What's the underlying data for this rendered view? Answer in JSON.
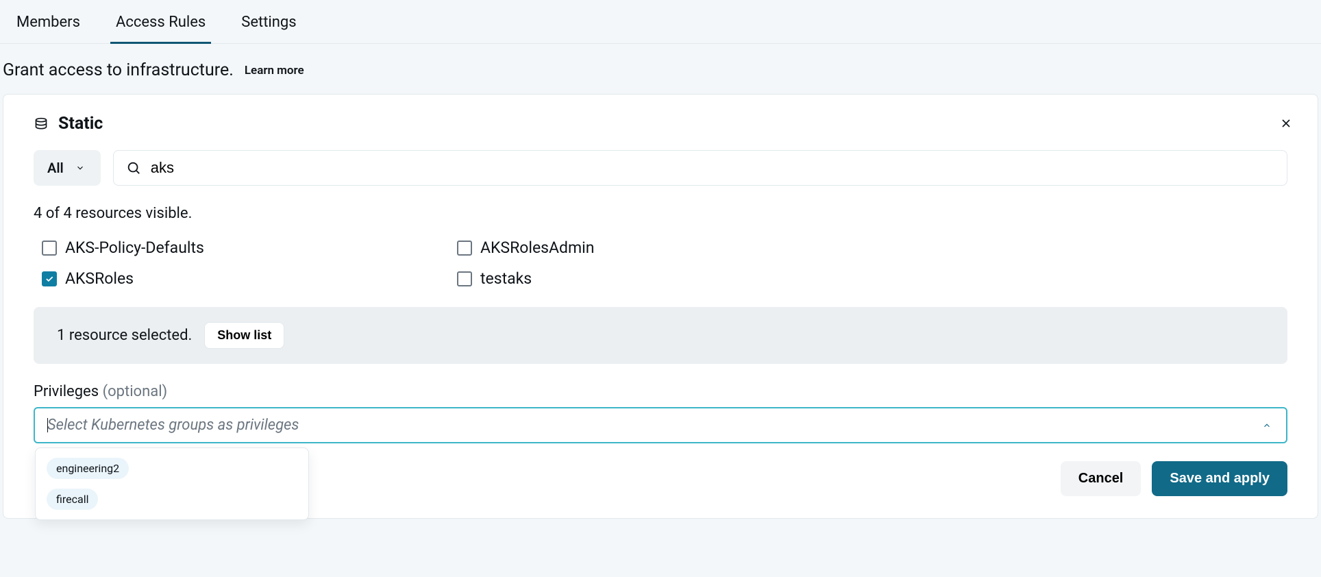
{
  "tabs": {
    "members": "Members",
    "access_rules": "Access Rules",
    "settings": "Settings"
  },
  "subhead": {
    "title": "Grant access to infrastructure.",
    "learn_more": "Learn more"
  },
  "panel": {
    "title": "Static",
    "filter_label": "All",
    "search_value": "aks",
    "resource_count": "4 of 4 resources visible.",
    "resources": [
      {
        "label": "AKS-Policy-Defaults",
        "checked": false
      },
      {
        "label": "AKSRolesAdmin",
        "checked": false
      },
      {
        "label": "AKSRoles",
        "checked": true
      },
      {
        "label": "testaks",
        "checked": false
      }
    ],
    "selected_text": "1 resource selected.",
    "show_list": "Show list",
    "privileges_label": "Privileges",
    "privileges_optional": "(optional)",
    "privileges_placeholder": "Select Kubernetes groups as privileges",
    "dropdown_options": [
      "engineering2",
      "firecall"
    ]
  },
  "actions": {
    "cancel": "Cancel",
    "save": "Save and apply"
  }
}
